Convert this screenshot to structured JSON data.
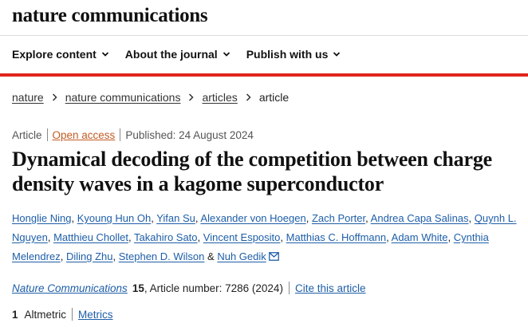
{
  "header": {
    "brand": "nature communications",
    "nav": [
      {
        "label": "Explore content"
      },
      {
        "label": "About the journal"
      },
      {
        "label": "Publish with us"
      }
    ]
  },
  "breadcrumb": [
    "nature",
    "nature communications",
    "articles",
    "article"
  ],
  "article": {
    "type": "Article",
    "open_access": "Open access",
    "published": "Published: 24 August 2024",
    "title": "Dynamical decoding of the competition between charge density waves in a kagome superconductor",
    "authors": [
      "Honglie Ning",
      "Kyoung Hun Oh",
      "Yifan Su",
      "Alexander von Hoegen",
      "Zach Porter",
      "Andrea Capa Salinas",
      "Quynh L. Nguyen",
      "Matthieu Chollet",
      "Takahiro Sato",
      "Vincent Esposito",
      "Matthias C. Hoffmann",
      "Adam White",
      "Cynthia Melendrez",
      "Diling Zhu",
      "Stephen D. Wilson",
      "Nuh Gedik"
    ],
    "author_comma": ",",
    "author_ampersand": "&",
    "journal": "Nature Communications",
    "volume": "15",
    "article_number": ", Article number: 7286 (2024)",
    "cite_label": "Cite this article",
    "altmetric_count": "1",
    "altmetric_label": "Altmetric",
    "metrics_label": "Metrics"
  },
  "colors": {
    "accent_red": "#e0251b",
    "link_blue": "#1e5ea8",
    "open_access_orange": "#c25b24"
  },
  "icons": {
    "nav_dropdown": "chevron-down-icon",
    "breadcrumb_separator": "chevron-right-icon",
    "corresponding_author": "mail-icon"
  }
}
